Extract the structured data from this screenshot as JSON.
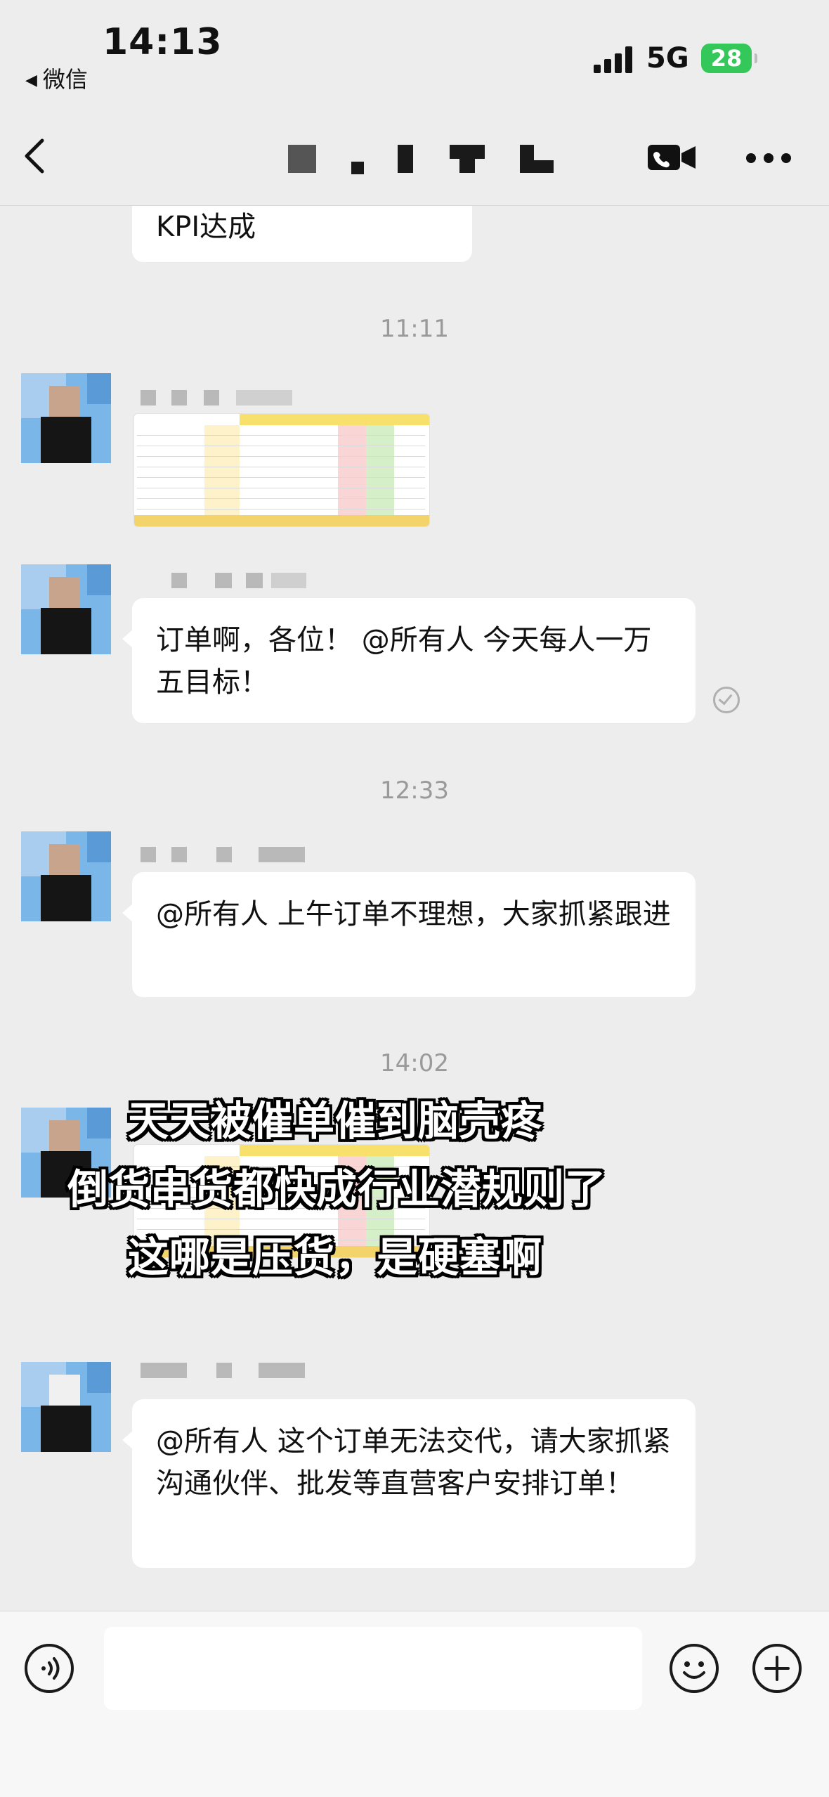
{
  "status_bar": {
    "time": "14:13",
    "back_app": "微信",
    "network": "5G",
    "battery": "28"
  },
  "nav": {
    "back_icon": "chevron-left-icon",
    "title_obscured": "pixelated-title",
    "video_call_icon": "video-camera-icon",
    "more_icon": "more-dots-icon"
  },
  "messages": {
    "kpi_text": "KPI达成",
    "ts_1": "11:11",
    "msg_1_text": "订单啊，各位！ @所有人 今天每人一万五目标！",
    "ts_2": "12:33",
    "msg_2_text": "@所有人 上午订单不理想，大家抓紧跟进",
    "ts_3": "14:02",
    "msg_3_text": "@所有人 这个订单无法交代，请大家抓紧沟通伙伴、批发等直营客户安排订单！"
  },
  "overlay": {
    "line_1": "天天被催单催到脑壳疼",
    "line_2": "倒货串货都快成行业潜规则了",
    "line_3": "这哪是压货，是硬塞啊"
  },
  "input_bar": {
    "voice_icon": "voice-icon",
    "emoji_icon": "emoji-icon",
    "plus_icon": "plus-icon",
    "placeholder": ""
  }
}
